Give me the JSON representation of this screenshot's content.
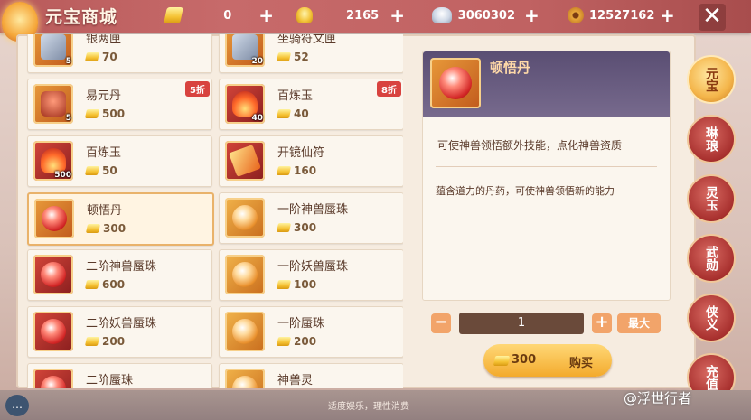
{
  "header": {
    "title": "元宝商城",
    "currencies": [
      {
        "icon": "gold-bar-icon",
        "value": "0"
      },
      {
        "icon": "gold-ingot-icon",
        "value": "2165"
      },
      {
        "icon": "silver-ingot-icon",
        "value": "3060302"
      },
      {
        "icon": "copper-coin-icon",
        "value": "12527162"
      }
    ],
    "plus": "+",
    "close": "✕"
  },
  "items": [
    {
      "name": "银两匣",
      "price": "70",
      "qty": "5",
      "discount": "",
      "art": "box"
    },
    {
      "name": "坐骑符文匣",
      "price": "52",
      "qty": "20",
      "discount": "",
      "art": "box"
    },
    {
      "name": "易元丹",
      "price": "500",
      "qty": "5",
      "discount": "5折",
      "art": "chest"
    },
    {
      "name": "百炼玉",
      "price": "40",
      "qty": "40",
      "discount": "8折",
      "art": "flame"
    },
    {
      "name": "百炼玉",
      "price": "50",
      "qty": "500",
      "discount": "",
      "art": "flame"
    },
    {
      "name": "开镜仙符",
      "price": "160",
      "qty": "",
      "discount": "",
      "art": "scroll"
    },
    {
      "name": "顿悟丹",
      "price": "300",
      "qty": "",
      "discount": "",
      "art": "orb-red"
    },
    {
      "name": "一阶神兽蜃珠",
      "price": "300",
      "qty": "",
      "discount": "",
      "art": "orb-gold"
    },
    {
      "name": "二阶神兽蜃珠",
      "price": "600",
      "qty": "",
      "discount": "",
      "art": "orb-red"
    },
    {
      "name": "一阶妖兽蜃珠",
      "price": "100",
      "qty": "",
      "discount": "",
      "art": "orb-gold"
    },
    {
      "name": "二阶妖兽蜃珠",
      "price": "200",
      "qty": "",
      "discount": "",
      "art": "orb-red"
    },
    {
      "name": "一阶蜃珠",
      "price": "200",
      "qty": "",
      "discount": "",
      "art": "orb-gold"
    },
    {
      "name": "二阶蜃珠",
      "price": "",
      "qty": "",
      "discount": "",
      "art": "orb-red"
    },
    {
      "name": "神兽灵",
      "price": "",
      "qty": "",
      "discount": "",
      "art": "orb-gold"
    }
  ],
  "selected_index": 6,
  "detail": {
    "name": "顿悟丹",
    "effect": "可使神兽领悟额外技能，点化神兽资质",
    "lore": "蕴含道力的丹药，可使神兽领悟新的能力"
  },
  "purchase": {
    "minus": "−",
    "quantity": "1",
    "plus": "+",
    "max_label": "最大",
    "price": "300",
    "buy_label": "购买"
  },
  "side_tabs": [
    {
      "label": "元宝",
      "active": true
    },
    {
      "label": "琳琅",
      "active": false
    },
    {
      "label": "灵玉",
      "active": false
    },
    {
      "label": "武勋",
      "active": false
    },
    {
      "label": "侠义",
      "active": false
    },
    {
      "label": "充值",
      "active": false
    }
  ],
  "footer": {
    "notice": "适度娱乐，理性消费",
    "watermark": "@浮世行者"
  }
}
